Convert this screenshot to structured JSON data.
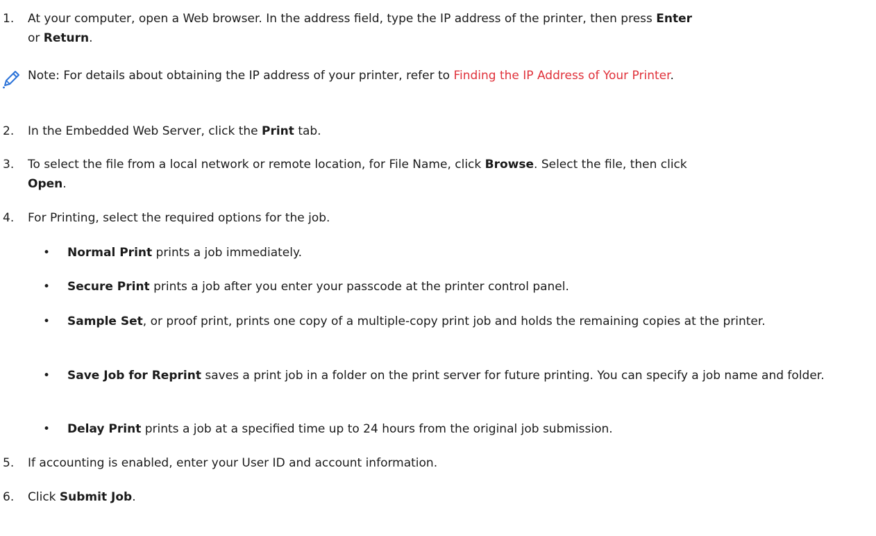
{
  "steps": {
    "s1": {
      "num": "1.",
      "pre": "At your computer, open a Web browser. In the address field, type the IP address of the printer, then press",
      "bold_a": "Enter",
      "mid": "or",
      "bold_b": "Return",
      "post": "."
    },
    "note": {
      "icon": "pencil-icon",
      "pre": "Note: For details about obtaining the IP address of your printer, refer to",
      "link": "Finding the IP Address of Your Printer",
      "post": "."
    },
    "s2": {
      "num": "2.",
      "pre": "In the Embedded Web Server, click the",
      "bold": "Print",
      "post": "tab."
    },
    "s3": {
      "num": "3.",
      "pre": "To select the file from a local network or remote location, for File Name, click",
      "bold_a": "Browse",
      "mid": ". Select the file, then click",
      "bold_b": "Open",
      "post": "."
    },
    "s4": {
      "num": "4.",
      "text": "For Printing, select the required options for the job."
    },
    "bullets": [
      {
        "bold": "Normal Print",
        "text": "prints a job immediately."
      },
      {
        "bold": "Secure Print",
        "text": "prints a job after you enter your passcode at the printer control panel."
      },
      {
        "bold": "Sample Set",
        "text": ", or proof print, prints one copy of a multiple-copy print job and holds the remaining copies at the printer."
      },
      {
        "bold": "Save Job for Reprint",
        "text": "saves a print job in a folder on the print server for future printing. You can specify a job name and folder."
      },
      {
        "bold": "Delay Print",
        "text": "prints a job at a specified time up to 24 hours from the original job submission."
      }
    ],
    "s5": {
      "num": "5.",
      "text": "If accounting is enabled, enter your User ID and account information."
    },
    "s6": {
      "num": "6.",
      "pre": "Click",
      "bold": "Submit Job",
      "post": "."
    }
  },
  "colors": {
    "link": "#e0313a",
    "pencil": "#2a72d8",
    "text": "#1a1a1a"
  }
}
